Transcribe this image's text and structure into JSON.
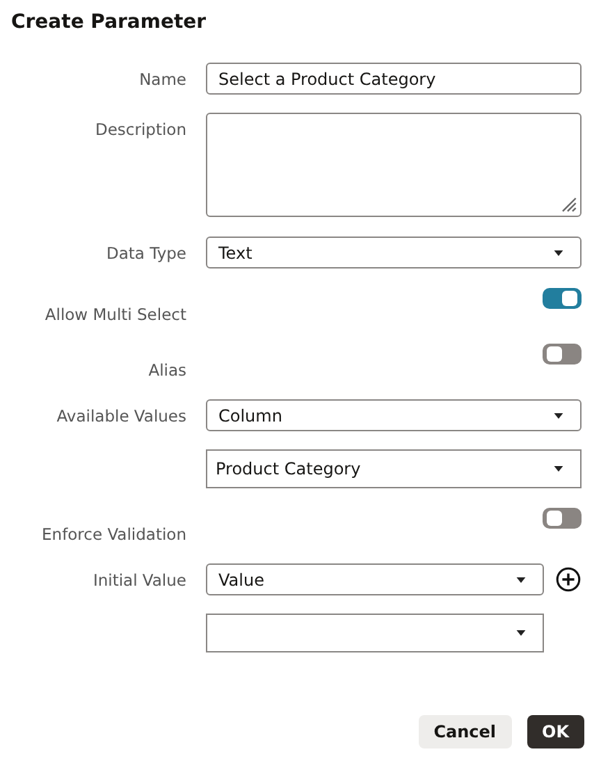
{
  "dialog": {
    "title": "Create Parameter"
  },
  "rows": [
    {
      "label": "Name",
      "kind": "text",
      "value": "Select a Product Category"
    },
    {
      "label": "Description",
      "kind": "textarea"
    },
    {
      "label": "Data Type",
      "kind": "select",
      "values": [
        {
          "kind": "select",
          "value": "Text"
        }
      ]
    },
    {
      "label": "Allow Multi Select",
      "kind": "toggle",
      "on": true
    },
    {
      "label": "Alias",
      "kind": "toggle",
      "on": false
    },
    {
      "label": "Available Values",
      "kind": "select",
      "values": [
        {
          "kind": "select",
          "value": "Column"
        },
        {
          "kind": "select",
          "value": "Product Category"
        }
      ]
    },
    {
      "label": "Enforce Validation",
      "kind": "toggle",
      "on": false
    },
    {
      "label": "Initial Value",
      "kind": "select",
      "values": [
        {
          "kind": "select",
          "value": "Value"
        },
        {
          "kind": "select"
        }
      ],
      "add_button": true
    }
  ],
  "buttons": [
    {
      "label": "Cancel",
      "primary": false
    },
    {
      "label": "OK",
      "primary": true
    }
  ]
}
